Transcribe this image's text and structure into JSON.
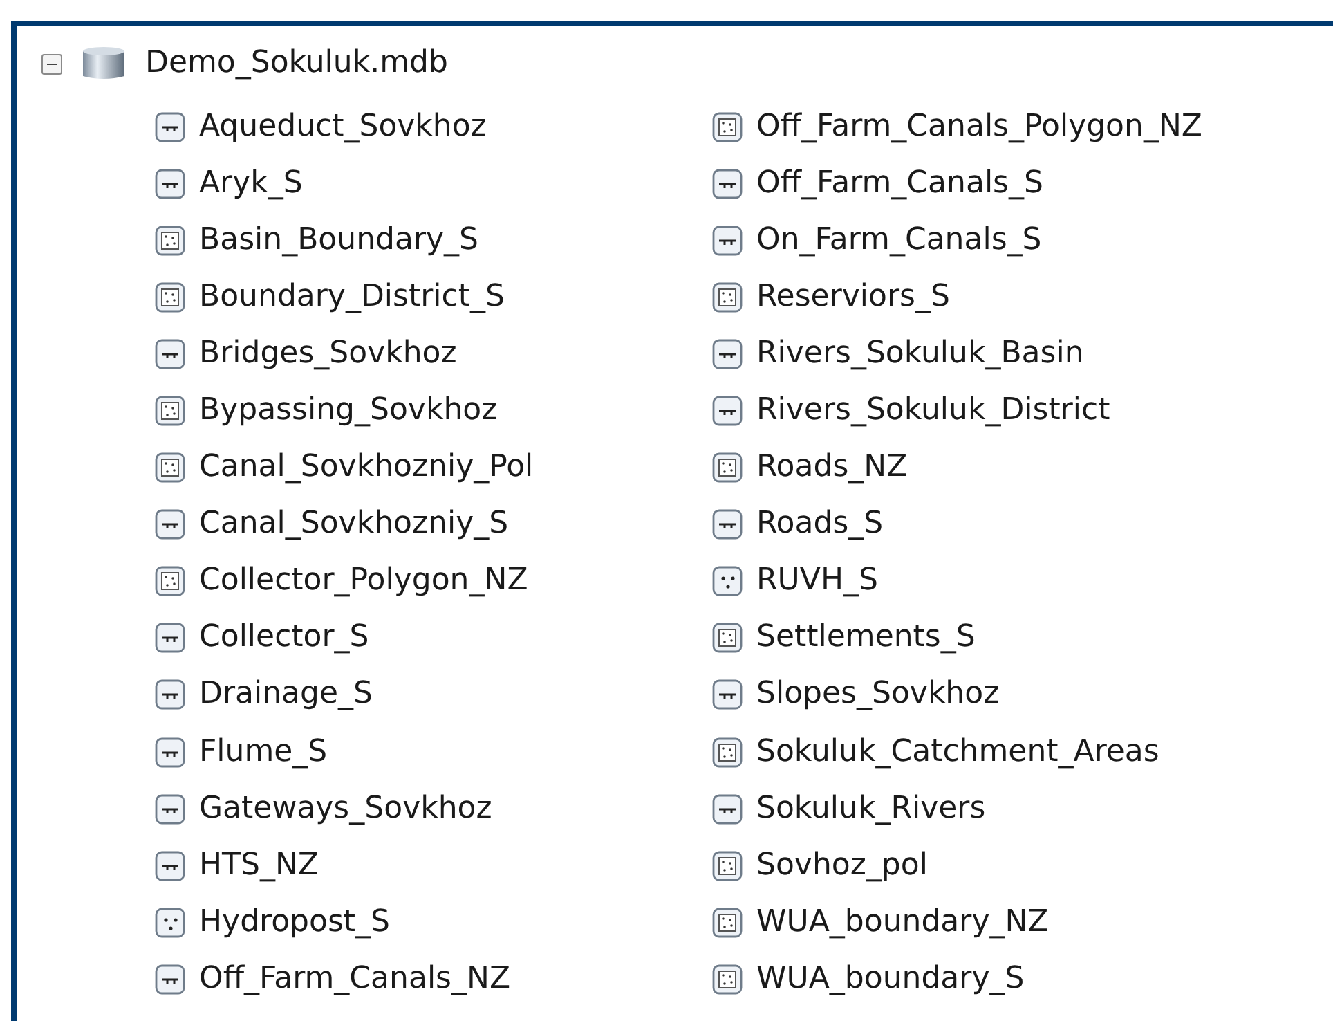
{
  "tree": {
    "label": "Demo_Sokuluk.mdb",
    "expanded": true,
    "children": [
      {
        "label": "Aqueduct_Sovkhoz",
        "kind": "line"
      },
      {
        "label": "Aryk_S",
        "kind": "line"
      },
      {
        "label": "Basin_Boundary_S",
        "kind": "polygon"
      },
      {
        "label": "Boundary_District_S",
        "kind": "polygon"
      },
      {
        "label": "Bridges_Sovkhoz",
        "kind": "line"
      },
      {
        "label": "Bypassing_Sovkhoz",
        "kind": "polygon"
      },
      {
        "label": "Canal_Sovkhozniy_Pol",
        "kind": "polygon"
      },
      {
        "label": "Canal_Sovkhozniy_S",
        "kind": "line"
      },
      {
        "label": "Collector_Polygon_NZ",
        "kind": "polygon"
      },
      {
        "label": "Collector_S",
        "kind": "line"
      },
      {
        "label": "Drainage_S",
        "kind": "line"
      },
      {
        "label": "Flume_S",
        "kind": "line"
      },
      {
        "label": "Gateways_Sovkhoz",
        "kind": "line"
      },
      {
        "label": "HTS_NZ",
        "kind": "line"
      },
      {
        "label": "Hydropost_S",
        "kind": "point"
      },
      {
        "label": "Off_Farm_Canals_NZ",
        "kind": "line"
      },
      {
        "label": "Off_Farm_Canals_Polygon_NZ",
        "kind": "polygon"
      },
      {
        "label": "Off_Farm_Canals_S",
        "kind": "line"
      },
      {
        "label": "On_Farm_Canals_S",
        "kind": "line"
      },
      {
        "label": "Reserviors_S",
        "kind": "polygon"
      },
      {
        "label": "Rivers_Sokuluk_Basin",
        "kind": "line"
      },
      {
        "label": "Rivers_Sokuluk_District",
        "kind": "line"
      },
      {
        "label": "Roads_NZ",
        "kind": "polygon"
      },
      {
        "label": "Roads_S",
        "kind": "line"
      },
      {
        "label": "RUVH_S",
        "kind": "point"
      },
      {
        "label": "Settlements_S",
        "kind": "polygon"
      },
      {
        "label": "Slopes_Sovkhoz",
        "kind": "line"
      },
      {
        "label": "Sokuluk_Catchment_Areas",
        "kind": "polygon"
      },
      {
        "label": "Sokuluk_Rivers",
        "kind": "line"
      },
      {
        "label": "Sovhoz_pol",
        "kind": "polygon"
      },
      {
        "label": "WUA_boundary_NZ",
        "kind": "polygon"
      },
      {
        "label": "WUA_boundary_S",
        "kind": "polygon"
      }
    ]
  }
}
